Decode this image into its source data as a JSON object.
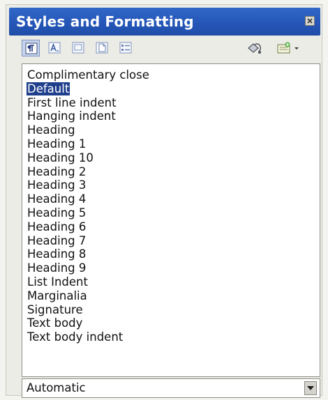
{
  "panel": {
    "title": "Styles and Formatting"
  },
  "toolbar": {
    "buttons": [
      {
        "icon": "paragraph-styles-icon",
        "active": true
      },
      {
        "icon": "character-styles-icon",
        "active": false
      },
      {
        "icon": "frame-styles-icon",
        "active": false
      },
      {
        "icon": "page-styles-icon",
        "active": false
      },
      {
        "icon": "list-styles-icon",
        "active": false
      },
      {
        "icon": "fill-format-mode-icon",
        "active": false
      },
      {
        "icon": "new-style-from-selection-icon",
        "active": false
      }
    ]
  },
  "styles": {
    "items": [
      "Complimentary close",
      "Default",
      "First line indent",
      "Hanging indent",
      "Heading",
      "Heading 1",
      "Heading 10",
      "Heading 2",
      "Heading 3",
      "Heading 4",
      "Heading 5",
      "Heading 6",
      "Heading 7",
      "Heading 8",
      "Heading 9",
      "List Indent",
      "Marginalia",
      "Signature",
      "Text body",
      "Text body indent"
    ],
    "selected": "Default"
  },
  "filter": {
    "value": "Automatic"
  },
  "colors": {
    "titlebar": "#2556b8",
    "selection": "#1f3f8c"
  }
}
